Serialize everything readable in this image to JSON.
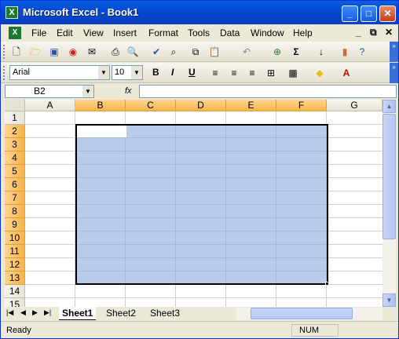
{
  "window": {
    "title": "Microsoft Excel - Book1"
  },
  "menu": [
    "File",
    "Edit",
    "View",
    "Insert",
    "Format",
    "Tools",
    "Data",
    "Window",
    "Help"
  ],
  "toolbar2": {
    "font_name": "Arial",
    "font_size": "10",
    "bold": "B",
    "italic": "I",
    "underline": "U"
  },
  "formula": {
    "name_box": "B2",
    "fx": "fx",
    "value": ""
  },
  "columns": [
    "A",
    "B",
    "C",
    "D",
    "E",
    "F",
    "G"
  ],
  "rows": [
    "1",
    "2",
    "3",
    "4",
    "5",
    "6",
    "7",
    "8",
    "9",
    "10",
    "11",
    "12",
    "13",
    "14",
    "15"
  ],
  "selection": {
    "range": "B2:F13",
    "active_cell": "B2"
  },
  "sheets": [
    "Sheet1",
    "Sheet2",
    "Sheet3"
  ],
  "active_sheet": "Sheet1",
  "status": {
    "text": "Ready",
    "num": "NUM"
  },
  "colors": {
    "titlebar": "#0a5fe0",
    "selection": "#8caae1",
    "header_selected": "#f7b449"
  }
}
